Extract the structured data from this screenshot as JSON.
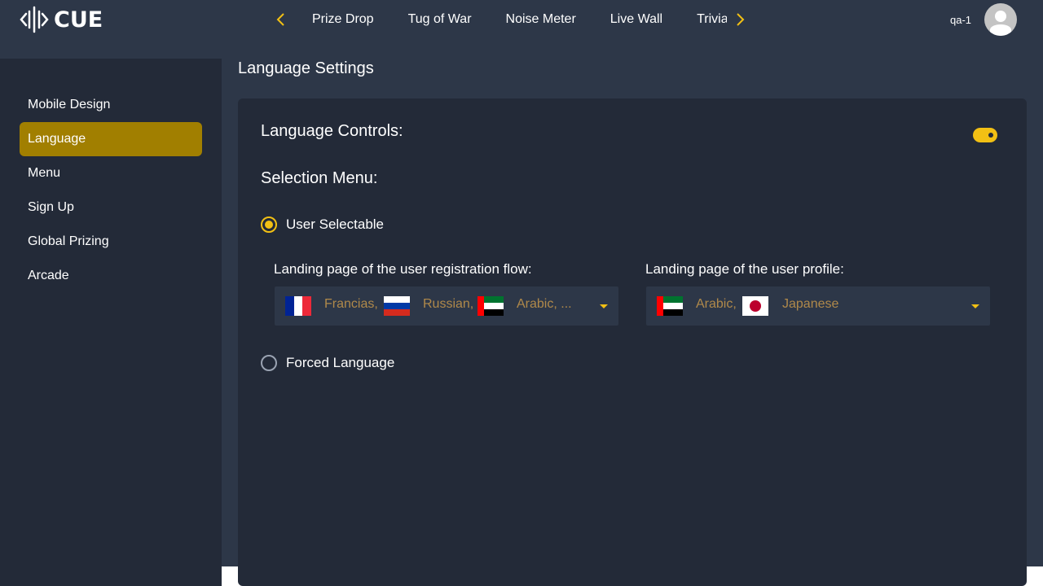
{
  "app": {
    "logo_text": "CUE"
  },
  "topnav": {
    "tabs": [
      "Prize Drop",
      "Tug of War",
      "Noise Meter",
      "Live Wall",
      "Trivia"
    ],
    "user": "qa-1"
  },
  "sidebar": {
    "items": [
      {
        "label": "Mobile Design"
      },
      {
        "label": "Language"
      },
      {
        "label": "Menu"
      },
      {
        "label": "Sign Up"
      },
      {
        "label": "Global Prizing"
      },
      {
        "label": "Arcade"
      }
    ],
    "active": "Language"
  },
  "page": {
    "title": "Language Settings"
  },
  "language_controls": {
    "label": "Language Controls:",
    "enabled": true
  },
  "selection_menu": {
    "label": "Selection Menu:",
    "options": [
      {
        "label": "User Selectable",
        "selected": true
      },
      {
        "label": "Forced Language",
        "selected": false
      }
    ]
  },
  "registration": {
    "label": "Landing page of the user registration flow:",
    "languages": [
      "Francias,",
      "Russian,",
      "Arabic, ..."
    ]
  },
  "profile": {
    "label": "Landing page of the user profile:",
    "languages": [
      "Arabic,",
      "Japanese"
    ]
  },
  "colors": {
    "accent": "#f2c014",
    "active_item": "#a17f00",
    "topbar_bg": "#2d3748",
    "panel_bg": "#232a38",
    "option_text": "#b0894a"
  },
  "icons": {
    "logo": "cue-logo-icon",
    "prev": "chevron-left-icon",
    "next": "chevron-right-icon",
    "avatar": "user-avatar-icon",
    "dropdown": "caret-down-icon",
    "flags": [
      "france-flag-icon",
      "russia-flag-icon",
      "uae-flag-icon",
      "japan-flag-icon"
    ]
  }
}
